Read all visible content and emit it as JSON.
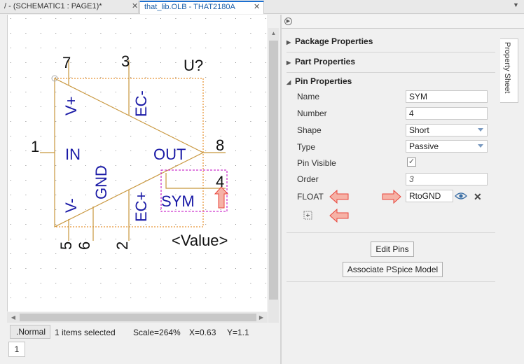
{
  "tabs": [
    {
      "label": "/ - (SCHEMATIC1 : PAGE1)*",
      "active": false
    },
    {
      "label": "that_lib.OLB - THAT2180A",
      "active": true
    }
  ],
  "schematic": {
    "part_ref": "U?",
    "value_label": "<Value>",
    "pins": [
      {
        "number": "7",
        "name": "V+"
      },
      {
        "number": "3",
        "name": "EC-"
      },
      {
        "number": "1",
        "name": "IN"
      },
      {
        "number": "8",
        "name": "OUT"
      },
      {
        "number": "4",
        "name": "SYM"
      },
      {
        "number": "5",
        "name": "V-"
      },
      {
        "number": "6",
        "name": "GND"
      },
      {
        "number": "2",
        "name": "EC+"
      }
    ],
    "colors": {
      "body": "#c8963c",
      "text": "#1a1aa6",
      "bbox": "#e07a00",
      "selection": "#c000c0",
      "arrow": "#e8463c"
    }
  },
  "statusbar": {
    "mode": ".Normal",
    "selection": "1 items selected",
    "scale": "Scale=264%",
    "x": "X=0.63",
    "y": "Y=1.1",
    "page": "1"
  },
  "panel": {
    "side_tab": "Property Sheet",
    "sections": {
      "package": "Package Properties",
      "part": "Part Properties",
      "pin": "Pin Properties"
    },
    "pin": {
      "name_label": "Name",
      "name_value": "SYM",
      "number_label": "Number",
      "number_value": "4",
      "shape_label": "Shape",
      "shape_value": "Short",
      "type_label": "Type",
      "type_value": "Passive",
      "visible_label": "Pin Visible",
      "visible_checked": true,
      "check_glyph": "✓",
      "order_label": "Order",
      "order_value": "3",
      "float_label": "FLOAT",
      "float_value": "RtoGND"
    },
    "buttons": {
      "edit_pins": "Edit Pins",
      "pspice": "Associate PSpice Model"
    },
    "icons": {
      "eye": "eye-icon",
      "delete": "x-icon",
      "add": "add-property-icon",
      "collapse": "collapse-icon"
    }
  }
}
